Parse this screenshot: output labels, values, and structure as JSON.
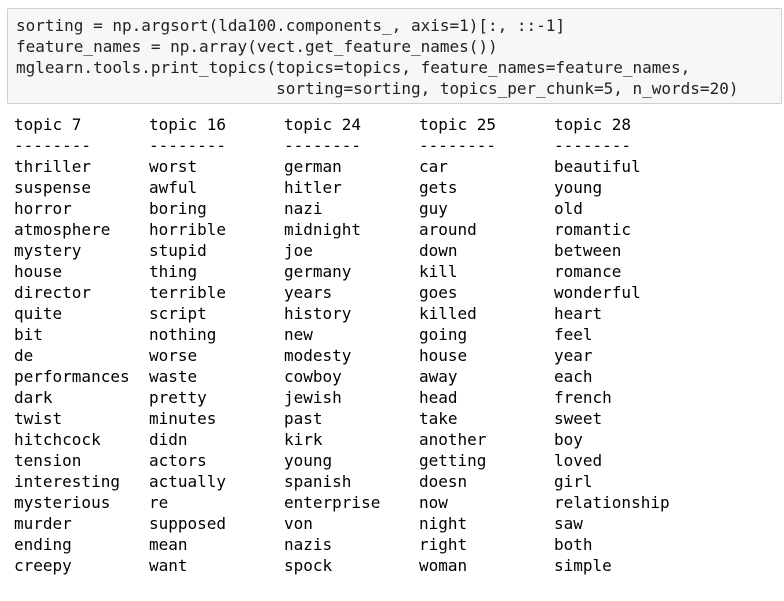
{
  "code_cell": {
    "lines": [
      "sorting = np.argsort(lda100.components_, axis=1)[:, ::-1]",
      "feature_names = np.array(vect.get_feature_names())",
      "mglearn.tools.print_topics(topics=topics, feature_names=feature_names,",
      "                           sorting=sorting, topics_per_chunk=5, n_words=20)"
    ]
  },
  "output": {
    "separator": "--------",
    "topics": [
      {
        "header": "topic 7",
        "words": [
          "thriller",
          "suspense",
          "horror",
          "atmosphere",
          "mystery",
          "house",
          "director",
          "quite",
          "bit",
          "de",
          "performances",
          "dark",
          "twist",
          "hitchcock",
          "tension",
          "interesting",
          "mysterious",
          "murder",
          "ending",
          "creepy"
        ]
      },
      {
        "header": "topic 16",
        "words": [
          "worst",
          "awful",
          "boring",
          "horrible",
          "stupid",
          "thing",
          "terrible",
          "script",
          "nothing",
          "worse",
          "waste",
          "pretty",
          "minutes",
          "didn",
          "actors",
          "actually",
          "re",
          "supposed",
          "mean",
          "want"
        ]
      },
      {
        "header": "topic 24",
        "words": [
          "german",
          "hitler",
          "nazi",
          "midnight",
          "joe",
          "germany",
          "years",
          "history",
          "new",
          "modesty",
          "cowboy",
          "jewish",
          "past",
          "kirk",
          "young",
          "spanish",
          "enterprise",
          "von",
          "nazis",
          "spock"
        ]
      },
      {
        "header": "topic 25",
        "words": [
          "car",
          "gets",
          "guy",
          "around",
          "down",
          "kill",
          "goes",
          "killed",
          "going",
          "house",
          "away",
          "head",
          "take",
          "another",
          "getting",
          "doesn",
          "now",
          "night",
          "right",
          "woman"
        ]
      },
      {
        "header": "topic 28",
        "words": [
          "beautiful",
          "young",
          "old",
          "romantic",
          "between",
          "romance",
          "wonderful",
          "heart",
          "feel",
          "year",
          "each",
          "french",
          "sweet",
          "boy",
          "loved",
          "girl",
          "relationship",
          "saw",
          "both",
          "simple"
        ]
      }
    ]
  }
}
